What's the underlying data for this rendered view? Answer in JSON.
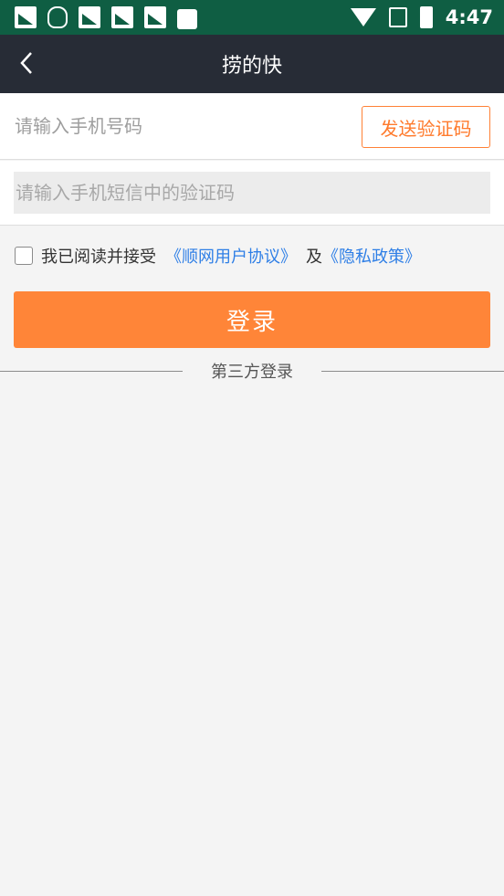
{
  "status_bar": {
    "time": "4:47",
    "icons": [
      "notification-icon",
      "qq-icon",
      "notification-icon",
      "notification-icon",
      "notification-icon",
      "shopping-bag-icon",
      "wifi-icon",
      "no-signal-icon",
      "battery-charging-icon"
    ]
  },
  "header": {
    "title": "捞的快",
    "back_icon": "chevron-left-icon"
  },
  "form": {
    "phone_placeholder": "请输入手机号码",
    "phone_value": "",
    "send_code_label": "发送验证码",
    "code_placeholder": "请输入手机短信中的验证码",
    "code_value": ""
  },
  "agreement": {
    "prefix": "我已阅读并接受",
    "user_agreement": "《顺网用户协议》",
    "and": "及",
    "privacy_policy": "《隐私政策》",
    "checked": false
  },
  "login_label": "登录",
  "third_party_label": "第三方登录",
  "colors": {
    "status_bar": "#0f5e43",
    "header": "#272c36",
    "accent": "#ff8538",
    "link": "#2f7fe6"
  }
}
